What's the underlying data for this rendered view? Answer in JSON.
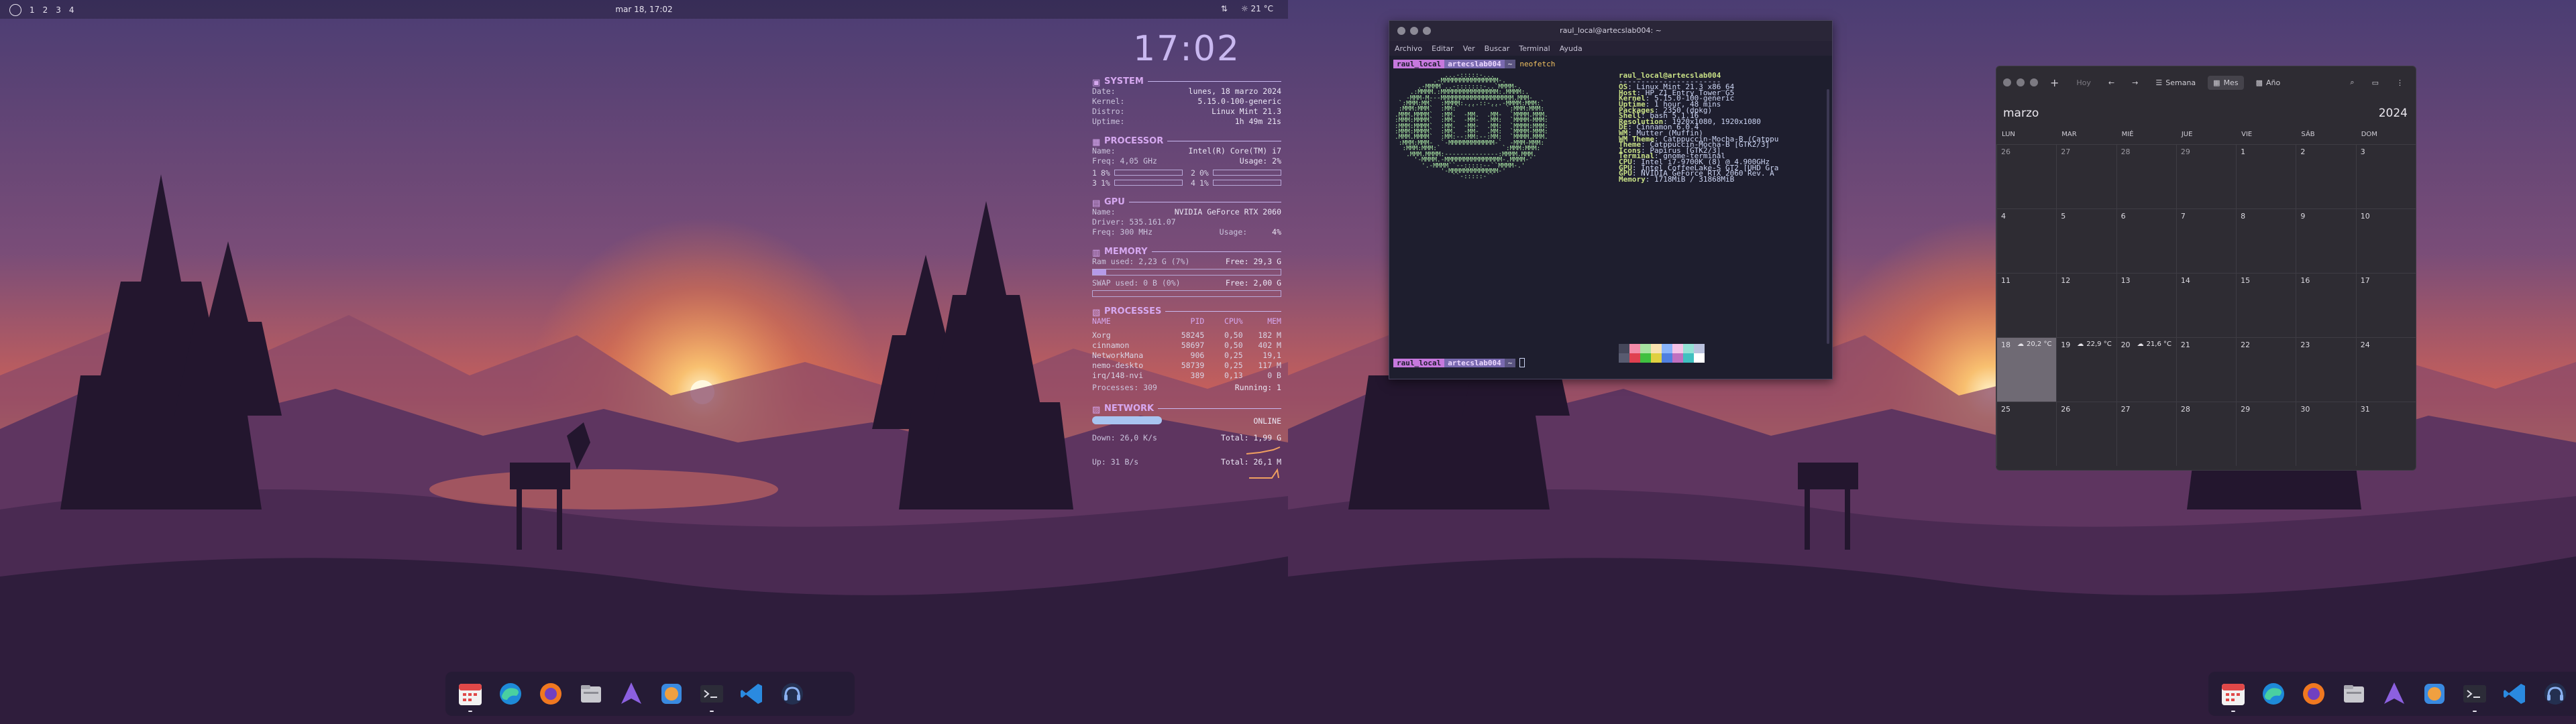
{
  "topbar": {
    "workspaces": [
      "1",
      "2",
      "3",
      "4"
    ],
    "datetime": "mar 18, 17:02",
    "network_icon": "network-icon",
    "weather": "21 °C"
  },
  "conky": {
    "time": "17:02",
    "system": {
      "title": "SYSTEM",
      "rows": [
        {
          "k": "Date:",
          "v": "lunes, 18 marzo 2024"
        },
        {
          "k": "Kernel:",
          "v": "5.15.0-100-generic"
        },
        {
          "k": "Distro:",
          "v": "Linux Mint 21.3"
        },
        {
          "k": "Uptime:",
          "v": "1h 49m 21s"
        }
      ]
    },
    "processor": {
      "title": "PROCESSOR",
      "name_k": "Name:",
      "name_v": "Intel(R) Core(TM) i7",
      "freq": "Freq: 4,05 GHz",
      "usage": "Usage: 2%",
      "cores": [
        {
          "label": "1",
          "pct": "8%"
        },
        {
          "label": "2",
          "pct": "0%"
        },
        {
          "label": "3",
          "pct": "1%"
        },
        {
          "label": "4",
          "pct": "1%"
        }
      ]
    },
    "gpu": {
      "title": "GPU",
      "name_k": "Name:",
      "name_v": "NVIDIA GeForce RTX 2060",
      "driver": "Driver: 535.161.07",
      "freq": "Freq: 300 MHz",
      "usage": "Usage:",
      "usage_v": "4%"
    },
    "memory": {
      "title": "MEMORY",
      "ram_used": "Ram used: 2,23 G (7%)",
      "ram_free": "Free: 29,3 G",
      "ram_pct": 7,
      "swap_used": "SWAP used: 0 B (0%)",
      "swap_free": "Free: 2,00 G",
      "swap_pct": 0
    },
    "processes": {
      "title": "PROCESSES",
      "headers": [
        "NAME",
        "PID",
        "CPU%",
        "MEM"
      ],
      "rows": [
        [
          "Xorg",
          "58245",
          "0,50",
          "182 M"
        ],
        [
          "cinnamon",
          "58697",
          "0,50",
          "402 M"
        ],
        [
          "NetworkMana",
          "906",
          "0,25",
          "19,1"
        ],
        [
          "nemo-deskto",
          "58739",
          "0,25",
          "117 M"
        ],
        [
          "irq/148-nvi",
          "389",
          "0,13",
          "0 B"
        ]
      ],
      "total": "Processes: 309",
      "running": "Running: 1"
    },
    "network": {
      "title": "NETWORK",
      "status": "ONLINE",
      "down": "Down: 26,0 K/s",
      "down_total": "Total: 1,99 G",
      "up": "Up: 31 B/s",
      "up_total": "Total: 26,1 M"
    }
  },
  "terminal": {
    "title": "raul_local@artecslab004: ~",
    "menu": [
      "Archivo",
      "Editar",
      "Ver",
      "Buscar",
      "Terminal",
      "Ayuda"
    ],
    "prompt_user": "raul_local",
    "prompt_host": "artecslab004",
    "prompt_dir": "~",
    "command": "neofetch",
    "ascii": "             ...-:::::-...\n          .-MMMMMMMMMMMMMMM-.\n      .-MMMM`..-:::::::-..`MMMM-.\n    .:MMMM.:MMMMMMMMMMMMMMM:.MMMM:.\n   -MMM-M---MMMMMMMMMMMMMMMMMMM.MMM-\n `:MMM:MM`  :MMMM:....::-...-MMMM:MMM:`\n :MMM:MMM`  :MM:`  ``    ``  `:MMM:MMM:\n.MMM.MMMM`  :MM.  -MM.  .MM-  `MMMM.MMM.\n:MMM:MMMM`  :MM.  -MM-  .MM:  `MMMM-MMM:\n:MMM:MMMM`  :MM.  -MM-  .MM:  `MMMM:MMM:\n:MMM:MMMM`  :MM.  -MM-  .MM:  `MMMM-MMM:\n.MMM.MMMM`  :MM:--:MM:--:MM:  `MMMM.MMM.\n :MMM:MMM-  `-MMMMMMMMMMMM-`  -MMM-MMM:\n  :MMM:MMM:`                `:MMM:MMM:\n   .MMM.MMMM:--------------:MMMM.MMM.\n     '-MMMM.-MMMMMMMMMMMMMMM-.MMMM-'\n       '.-MMMM``--:::::--``MMMM-.'\n            '-MMMMMMMMMMMMM-'\n               ``-:::::-``",
    "info_title": "raul_local@artecslab004",
    "info_sep": "-----------------------",
    "info": [
      {
        "k": "OS",
        "v": ": Linux Mint 21.3 x86_64"
      },
      {
        "k": "Host",
        "v": ": HP Z1 Entry Tower G5"
      },
      {
        "k": "Kernel",
        "v": ": 5.15.0-100-generic"
      },
      {
        "k": "Uptime",
        "v": ": 1 hour, 48 mins"
      },
      {
        "k": "Packages",
        "v": ": 2350 (dpkg)"
      },
      {
        "k": "Shell",
        "v": ": bash 5.1.16"
      },
      {
        "k": "Resolution",
        "v": ": 1920x1080, 1920x1080"
      },
      {
        "k": "DE",
        "v": ": Cinnamon 6.0.4"
      },
      {
        "k": "WM",
        "v": ": Mutter (Muffin)"
      },
      {
        "k": "WM Theme",
        "v": ": Catppuccin-Mocha-B (Catppu"
      },
      {
        "k": "Theme",
        "v": ": Catppuccin-Mocha-B [GTK2/3]"
      },
      {
        "k": "Icons",
        "v": ": Papirus [GTK2/3]"
      },
      {
        "k": "Terminal",
        "v": ": gnome-terminal"
      },
      {
        "k": "CPU",
        "v": ": Intel i7-9700K (8) @ 4.900GHz"
      },
      {
        "k": "GPU",
        "v": ": Intel CoffeeLake-S GT2 [UHD Gra"
      },
      {
        "k": "GPU",
        "v": ": NVIDIA GeForce RTX 2060 Rev. A"
      },
      {
        "k": "Memory",
        "v": ": 1718MiB / 31868MiB"
      }
    ],
    "palette": [
      "#45475a",
      "#f38ba8",
      "#a6e3a1",
      "#f9e2af",
      "#89b4fa",
      "#f5c2e7",
      "#94e2d5",
      "#bac2de",
      "#585b70",
      "#e04050",
      "#40c040",
      "#e0d040",
      "#5080e0",
      "#c070c0",
      "#40c0c0",
      "#ffffff"
    ]
  },
  "dock": {
    "apps": [
      {
        "name": "calendar-app-icon",
        "color": "#e04848"
      },
      {
        "name": "edge-browser-icon",
        "color": "#1ea0d8"
      },
      {
        "name": "firefox-icon",
        "color": "#f07820"
      },
      {
        "name": "files-app-icon",
        "color": "#a0a0a8"
      },
      {
        "name": "proton-vpn-icon",
        "color": "#8c60e0"
      },
      {
        "name": "blender-like-app-icon",
        "color": "#f0a040"
      },
      {
        "name": "terminal-icon",
        "color": "#3a3a48"
      },
      {
        "name": "vscode-icon",
        "color": "#2a8ae0"
      },
      {
        "name": "headphones-app-icon",
        "color": "#304070"
      }
    ]
  },
  "calendar": {
    "toolbar": {
      "add": "+",
      "today": "Hoy",
      "prev": "←",
      "next": "→",
      "week": "Semana",
      "month": "Mes",
      "year": "Año"
    },
    "month": "marzo",
    "year": "2024",
    "dows": [
      "LUN",
      "MAR",
      "MIÉ",
      "JUE",
      "VIE",
      "SÁB",
      "DOM"
    ],
    "days": [
      "26",
      "27",
      "28",
      "29",
      "1",
      "2",
      "3",
      "4",
      "5",
      "6",
      "7",
      "8",
      "9",
      "10",
      "11",
      "12",
      "13",
      "14",
      "15",
      "16",
      "17",
      "18",
      "19",
      "20",
      "21",
      "22",
      "23",
      "24",
      "25",
      "26",
      "27",
      "28",
      "29",
      "30",
      "31"
    ],
    "weather": [
      {
        "day": "18",
        "temp": "20,2 °C"
      },
      {
        "day": "19",
        "temp": "22,9 °C"
      },
      {
        "day": "20",
        "temp": "21,6 °C"
      }
    ]
  }
}
